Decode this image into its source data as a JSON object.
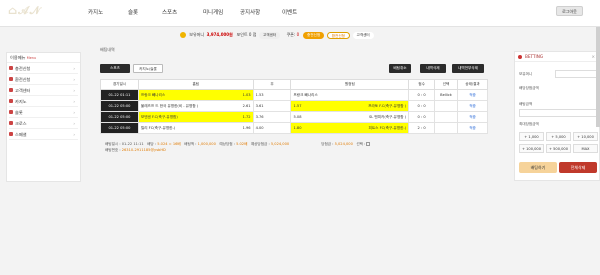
{
  "nav": {
    "items": [
      "카지노",
      "슬롯",
      "스포츠",
      "미니게임",
      "공지사항",
      "이벤트"
    ],
    "login_label": "로그아웃"
  },
  "status": {
    "balance_label": "보유머니",
    "balance_value": "3,974,000원",
    "point_label": "포인트",
    "point_value": "0",
    "point_unit": "점",
    "coupon_label": "쿠폰",
    "coupon_value": "0",
    "charge_label": "충전신청",
    "exchange_label": "환전신청",
    "support_label": "고객센터"
  },
  "sidebar": {
    "header": "이용메뉴",
    "header_sub": "Menu",
    "items": [
      "충전신청",
      "환전신청",
      "고객센터",
      "카지노",
      "슬롯",
      "크로스",
      "스페셜"
    ]
  },
  "center": {
    "title": "배팅내역",
    "tabs": [
      "스포츠",
      "카지노/슬롯"
    ],
    "action_buttons": [
      "배팅취소",
      "내역삭제",
      "내역전부삭제"
    ],
    "table_headers": [
      "경기일시",
      "홈팀",
      "무",
      "원정팀",
      "점수",
      "선택",
      "상태/결과"
    ],
    "rows": [
      {
        "date": "01-22 01:11",
        "home": "프랑크 빼나리스",
        "home_odds": "1.03",
        "draw": "1.53",
        "away": "프랑크 빼나리스",
        "away_odds": "",
        "score": "0 : 0",
        "pick": "Bellick",
        "status": "적중"
      },
      {
        "date": "01-22 05:00",
        "home": "불레즈프 드 한국 유명한(비 - 유명함 )",
        "home_odds": "2.61",
        "draw": "3.61",
        "away": "프라토 F.C(축구-유명함 )",
        "away_odds": "1.57",
        "score": "0 : 0",
        "pick": "",
        "status": "적중"
      },
      {
        "date": "01-22 05:00",
        "home": "보덴센 F.C(축구-유명함)",
        "home_odds": "1.72",
        "draw": "3.76",
        "away": "SL 벤피카(축구-유명함 )",
        "away_odds": "5.08",
        "score": "0 : 0",
        "pick": "",
        "status": "적중"
      },
      {
        "date": "01-22 05:00",
        "home": "릴리 FC(축구-유명한-)",
        "home_odds": "1.96",
        "draw": "4.00",
        "away": "피트스 FC(축구-유명한-) ",
        "away_odds": "1.80",
        "score": "2 : 0",
        "pick": "",
        "status": "적중"
      }
    ],
    "summary": {
      "bet_date_label": "배팅일시 :",
      "bet_date": "01-22 11:11",
      "odds_label": "배당 :",
      "odds": "5.024 = 16배",
      "bet_amount_label": "배팅액 :",
      "bet_amount": "1,000,000",
      "win_label": "예상당첨 :",
      "win_value": "5.02배",
      "expected_label": "예상당첨금 :",
      "expected_value": "5,024,000",
      "result_label": "당첨금 :",
      "result_value": "5,024,000",
      "select_label": "선택 :",
      "bet_no_label": "배팅번호 :",
      "bet_no": "26310-2911185@ysbHD"
    }
  },
  "betslip": {
    "title": "BETTING",
    "fields": [
      "보유머니",
      "배당당첨금액",
      "배팅금액",
      "최대당첨금액"
    ],
    "chips": [
      "+ 1,000",
      "+ 5,000",
      "+ 10,000",
      "+ 100,000",
      "+ 500,000",
      "MAX"
    ],
    "bet_button": "배팅하기",
    "cancel_button": "전체삭제"
  },
  "colors": {
    "highlight": "#ffff00",
    "dark": "#222222",
    "accent": "#f0a000"
  }
}
